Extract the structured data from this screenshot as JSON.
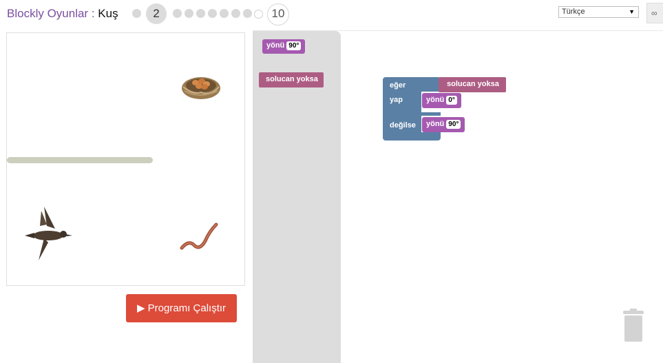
{
  "header": {
    "app_title": "Blockly Oyunlar",
    "separator": " : ",
    "game_name": "Kuş",
    "current_level": "2",
    "last_level": "10",
    "language": "Türkçe",
    "link_icon": "link-icon"
  },
  "game": {
    "run_button_label": "Programı Çalıştır",
    "run_icon": "play-icon",
    "sprites": [
      "bird",
      "nest",
      "worm"
    ]
  },
  "toolbox": {
    "heading_block": {
      "label": "yönü",
      "value": "90°"
    },
    "condition_block": {
      "label": "solucan yoksa"
    }
  },
  "workspace": {
    "if_block": {
      "if_label": "eğer",
      "condition": "solucan yoksa",
      "do_label": "yap",
      "do_heading": {
        "label": "yönü",
        "value": "0°"
      },
      "else_label": "değilse",
      "else_heading": {
        "label": "yönü",
        "value": "90°"
      }
    },
    "trash_icon": "trash-icon"
  },
  "colors": {
    "title": "#7b4fa0",
    "run_button": "#dd4b39",
    "heading_block": "#a55ab0",
    "condition_block": "#ad5d83",
    "logic_block": "#5b80a5"
  }
}
